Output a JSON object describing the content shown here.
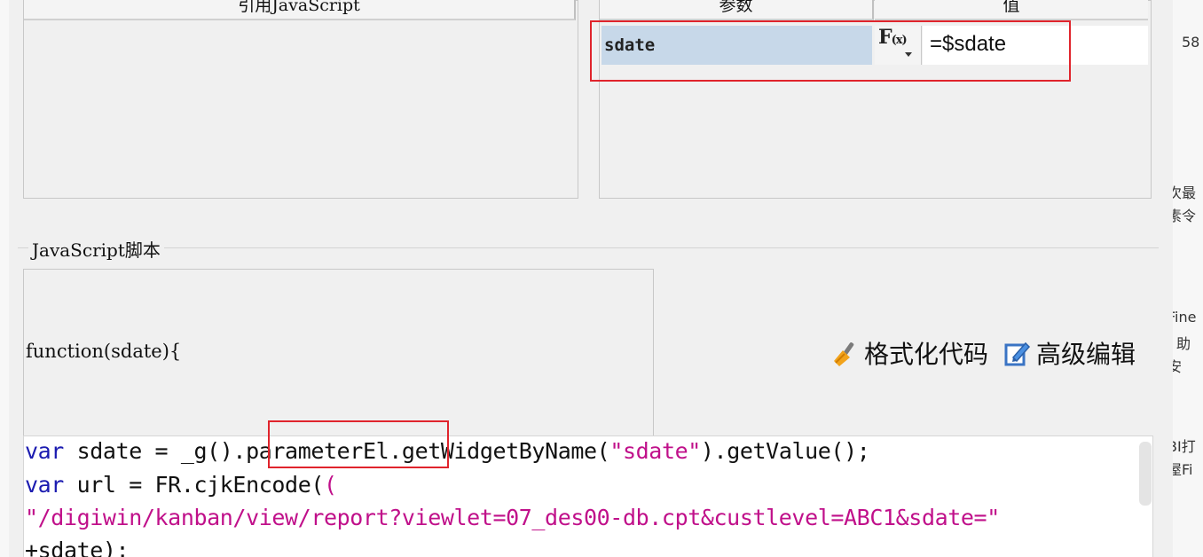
{
  "background": {
    "right_fragments": [
      "58",
      "次最",
      "素令",
      "Fine",
      "助",
      "安",
      "BI打",
      "屋Fi"
    ]
  },
  "left_panel": {
    "header": "引用JavaScript"
  },
  "param_table": {
    "col_param": "参数",
    "col_value": "值",
    "rows": [
      {
        "name": "sdate",
        "fx_icon": "F(x)",
        "value": "=$sdate"
      }
    ]
  },
  "script_section": {
    "title": "JavaScript脚本",
    "function_signature": "function(sdate){",
    "toolbar": {
      "format_label": "格式化代码",
      "format_icon": "broom-icon",
      "advanced_label": "高级编辑",
      "advanced_icon": "edit-icon"
    },
    "code": {
      "line1": {
        "kw": "var",
        "a": " sdate = _g().",
        "b": "parameterEl",
        "c": ".getWidgetByName(",
        "s": "\"sdate\"",
        "d": ").getValue();"
      },
      "line2": {
        "kw": "var",
        "a": " url = FR.cjkEncode("
      },
      "line3": {
        "s": "\"/digiwin/kanban/view/report?viewlet=07_des00-db.cpt&custlevel=ABC1&sdate=\""
      },
      "line4": {
        "a": "+sdate);"
      }
    }
  },
  "colors": {
    "keyword": "#1b1bb0",
    "string": "#c0108a",
    "highlight": "#e0242c",
    "param_cell": "#c7d8e9"
  }
}
